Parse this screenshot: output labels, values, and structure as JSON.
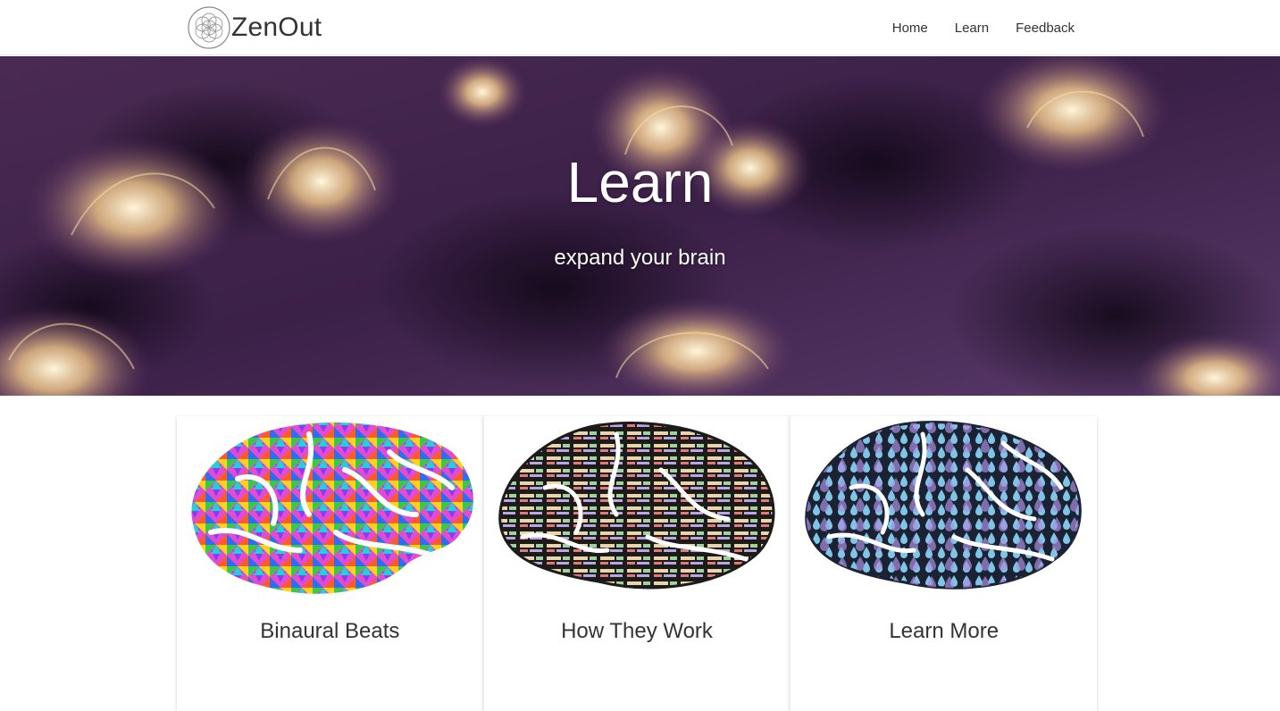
{
  "brand": {
    "name": "ZenOut",
    "logo_icon": "flower-of-life-icon"
  },
  "nav": {
    "items": [
      {
        "label": "Home"
      },
      {
        "label": "Learn"
      },
      {
        "label": "Feedback"
      }
    ]
  },
  "hero": {
    "title": "Learn",
    "subtitle": "expand your brain"
  },
  "cards": [
    {
      "title": "Binaural Beats",
      "image": "colorful-mosaic-brain-icon"
    },
    {
      "title": "How They Work",
      "image": "word-cloud-brain-icon"
    },
    {
      "title": "Learn More",
      "image": "raindrop-brain-icon"
    }
  ],
  "colors": {
    "hero_bg": "#3a1f4a",
    "hero_glow": "#f6d59a",
    "text_dark": "#333333"
  }
}
